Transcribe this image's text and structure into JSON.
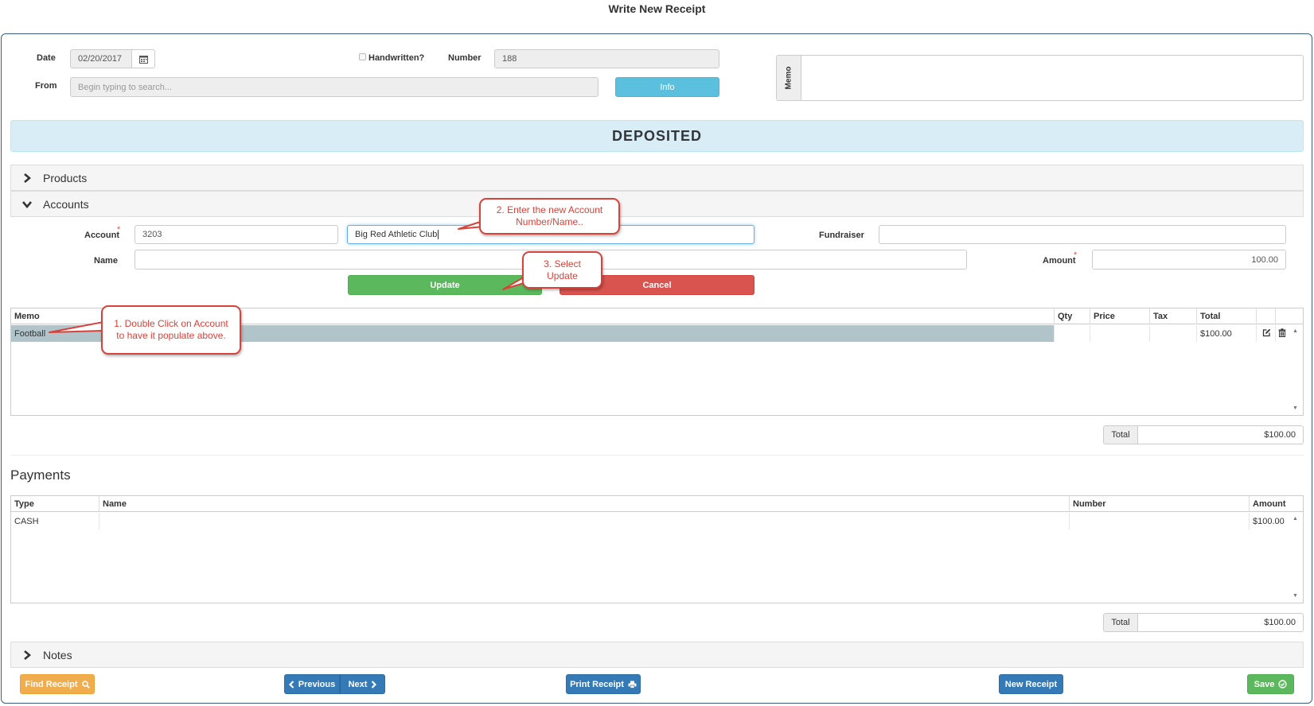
{
  "window": {
    "title": "Write New Receipt"
  },
  "header": {
    "date_label": "Date",
    "date_value": "02/20/2017",
    "handwritten_label": "Handwritten?",
    "number_label": "Number",
    "number_value": "188",
    "from_label": "From",
    "from_placeholder": "Begin typing to search...",
    "info_button": "Info",
    "memo_label": "Memo"
  },
  "status_banner": "DEPOSITED",
  "sections": {
    "products": "Products",
    "accounts": "Accounts",
    "notes": "Notes"
  },
  "account_form": {
    "account_label": "Account",
    "account_number": "3203",
    "account_name": "Big Red Athletic Club",
    "fundraiser_label": "Fundraiser",
    "name_label": "Name",
    "amount_label": "Amount",
    "amount_value": "100.00",
    "required_mark": "*",
    "update_button": "Update",
    "cancel_button": "Cancel"
  },
  "lines_grid": {
    "columns": [
      "Memo",
      "Qty",
      "Price",
      "Tax",
      "Total"
    ],
    "rows": [
      {
        "memo": "Football",
        "qty": "",
        "price": "",
        "tax": "",
        "total": "$100.00"
      }
    ],
    "total_label": "Total",
    "total_value": "$100.00"
  },
  "payments": {
    "title": "Payments",
    "columns": [
      "Type",
      "Name",
      "Number",
      "Amount"
    ],
    "rows": [
      {
        "type": "CASH",
        "name": "",
        "number": "",
        "amount": "$100.00"
      }
    ],
    "total_label": "Total",
    "total_value": "$100.00"
  },
  "footer": {
    "find_receipt": "Find Receipt",
    "previous": "Previous",
    "next": "Next",
    "print_receipt": "Print Receipt",
    "new_receipt": "New Receipt",
    "save": "Save"
  },
  "annotations": {
    "step1": "1. Double Click on Account to have it populate above.",
    "step2": "2. Enter the new Account Number/Name..",
    "step3": "3. Select Update"
  },
  "icons": [
    "calendar-icon",
    "chevron-right-icon",
    "chevron-down-icon",
    "edit-icon",
    "trash-icon",
    "search-icon",
    "print-icon",
    "check-circle-icon"
  ],
  "colors": {
    "success": "#5cb85c",
    "danger": "#d9534f",
    "info": "#5bc0de",
    "primary": "#337ab7",
    "warning": "#f0ad4e",
    "banner": "#d9edf7",
    "selected_row": "#b0c4c9",
    "callout": "#d9423a"
  }
}
